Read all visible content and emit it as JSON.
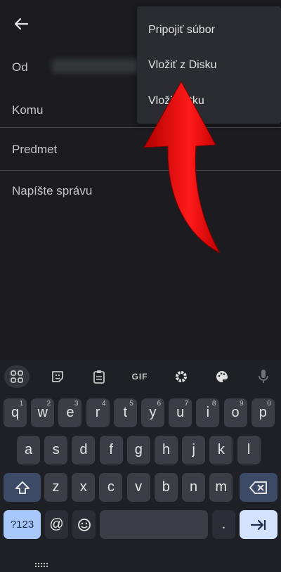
{
  "compose": {
    "from_label": "Od",
    "to_label": "Komu",
    "subject_placeholder": "Predmet",
    "body_placeholder": "Napíšte správu"
  },
  "menu": {
    "items": [
      "Pripojiť súbor",
      "Vložiť z Disku",
      "Vložiť fotku"
    ]
  },
  "keyboard": {
    "toolbar": [
      "apps-icon",
      "sticker-icon",
      "clipboard-icon",
      "GIF",
      "gear-icon",
      "palette-icon",
      "mic-icon"
    ],
    "row1": [
      {
        "k": "q",
        "h": "1"
      },
      {
        "k": "w",
        "h": "2"
      },
      {
        "k": "e",
        "h": "3"
      },
      {
        "k": "r",
        "h": "4"
      },
      {
        "k": "t",
        "h": "5"
      },
      {
        "k": "y",
        "h": "6"
      },
      {
        "k": "u",
        "h": "7"
      },
      {
        "k": "i",
        "h": "8"
      },
      {
        "k": "o",
        "h": "9"
      },
      {
        "k": "p",
        "h": "0"
      }
    ],
    "row2": [
      "a",
      "s",
      "d",
      "f",
      "g",
      "h",
      "j",
      "k",
      "l"
    ],
    "row3": [
      "z",
      "x",
      "c",
      "v",
      "b",
      "n",
      "m"
    ],
    "symbols_label": "?123",
    "at_label": "@",
    "period_label": "."
  },
  "colors": {
    "background": "#1c1c20",
    "menu": "#2b2c31",
    "arrow": "#e00000",
    "enter_key": "#d3e3fd",
    "symbols_key": "#a8c7fa"
  }
}
